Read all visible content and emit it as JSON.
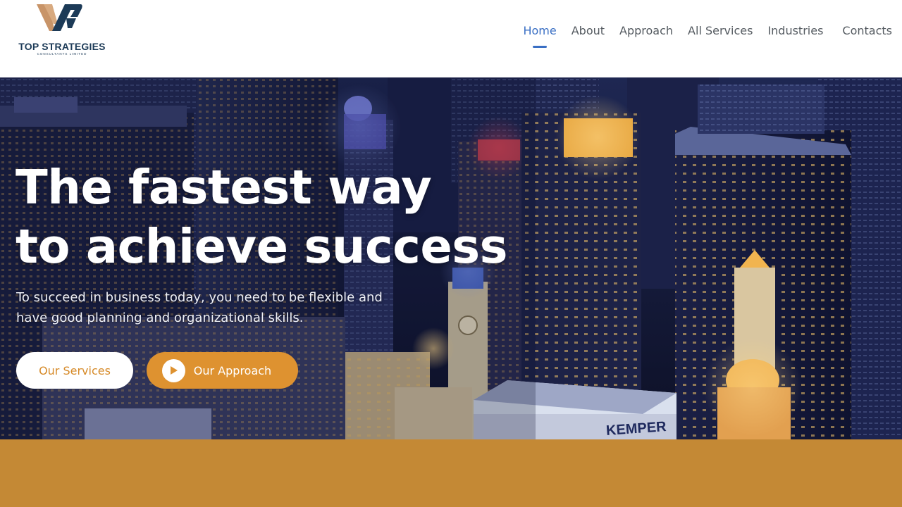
{
  "brand": {
    "name": "TOP STRATEGIES",
    "tagline": "CONSULTANTS LIMITED"
  },
  "nav": {
    "items": [
      {
        "label": "Home",
        "active": true
      },
      {
        "label": "About",
        "active": false
      },
      {
        "label": "Approach",
        "active": false
      },
      {
        "label": "All Services",
        "active": false
      },
      {
        "label": "Industries",
        "active": false
      },
      {
        "label": "Contacts",
        "active": false
      }
    ]
  },
  "hero": {
    "headline_line1": "The fastest way",
    "headline_line2": "to achieve success",
    "subtitle_line1": "To succeed in business today, you need to be flexible and",
    "subtitle_line2": "have good planning and organizational skills.",
    "primary_button": "Our Services",
    "secondary_button": "Our Approach",
    "secondary_button_icon": "play-icon",
    "building_sign": "KEMPER"
  },
  "colors": {
    "accent_blue": "#3a6fc4",
    "accent_orange": "#de9230",
    "band": "#c48935",
    "brand_navy": "#1c3a57"
  }
}
